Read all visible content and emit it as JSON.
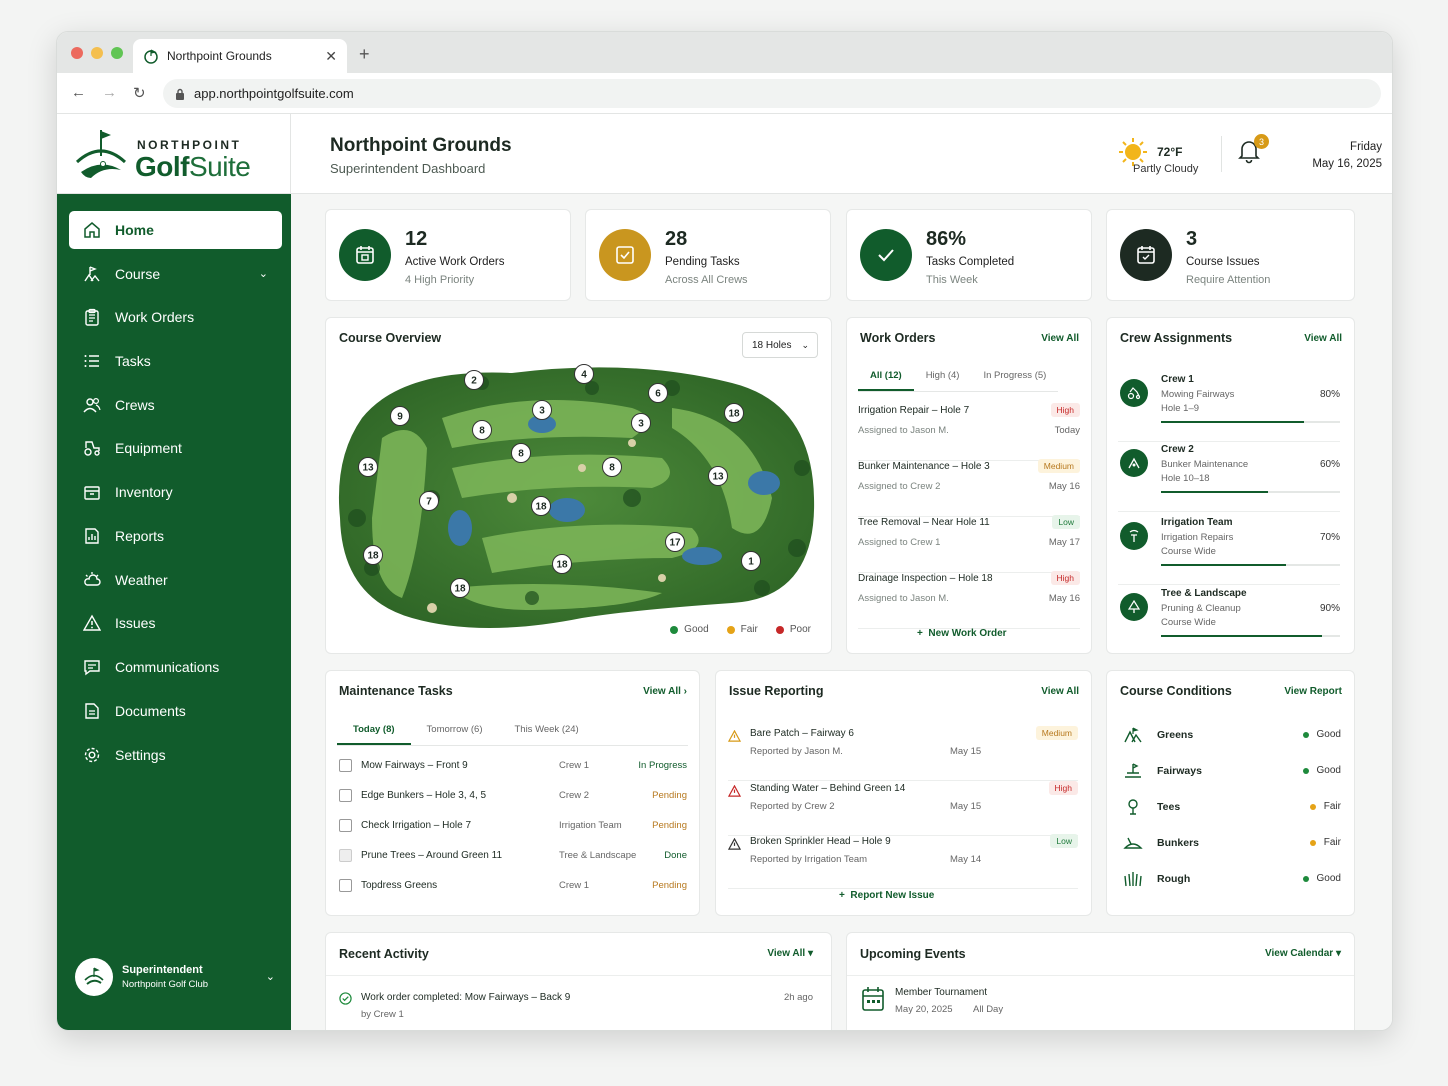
{
  "browser": {
    "tab_title": "Northpoint Grounds",
    "url": "app.northpointgolfsuite.com"
  },
  "brand": {
    "line1": "NORTHPOINT",
    "golf": "Golf",
    "suite": "Suite"
  },
  "sidebar": {
    "items": [
      {
        "label": "Home",
        "icon": "home-icon"
      },
      {
        "label": "Course",
        "icon": "course-icon"
      },
      {
        "label": "Work Orders",
        "icon": "clipboard-icon"
      },
      {
        "label": "Tasks",
        "icon": "list-icon"
      },
      {
        "label": "Crews",
        "icon": "users-icon"
      },
      {
        "label": "Equipment",
        "icon": "tractor-icon"
      },
      {
        "label": "Inventory",
        "icon": "box-icon"
      },
      {
        "label": "Reports",
        "icon": "chart-icon"
      },
      {
        "label": "Weather",
        "icon": "weather-icon"
      },
      {
        "label": "Issues",
        "icon": "warning-icon"
      },
      {
        "label": "Communications",
        "icon": "chat-icon"
      },
      {
        "label": "Documents",
        "icon": "document-icon"
      },
      {
        "label": "Settings",
        "icon": "gear-icon"
      }
    ],
    "user": {
      "role": "Superintendent",
      "club": "Northpoint Golf Club"
    }
  },
  "header": {
    "title": "Northpoint Grounds",
    "subtitle": "Superintendent Dashboard",
    "weather_temp": "72°F",
    "weather_cond": "Partly Cloudy",
    "notif_count": "3",
    "day": "Friday",
    "date": "May 16, 2025"
  },
  "stats": [
    {
      "value": "12",
      "label": "Active Work Orders",
      "sub": "4 High Priority",
      "color": "#115c2c"
    },
    {
      "value": "28",
      "label": "Pending Tasks",
      "sub": "Across All Crews",
      "color": "#c9961f"
    },
    {
      "value": "86%",
      "label": "Tasks Completed",
      "sub": "This Week",
      "color": "#115c2c"
    },
    {
      "value": "3",
      "label": "Course Issues",
      "sub": "Require Attention",
      "color": "#1d2a22"
    }
  ],
  "course_overview": {
    "title": "Course Overview",
    "select": "18 Holes",
    "hole_markers": [
      "2",
      "4",
      "6",
      "9",
      "3",
      "8",
      "3",
      "18",
      "13",
      "8",
      "8",
      "13",
      "7",
      "18",
      "17",
      "18",
      "18",
      "1",
      "18"
    ],
    "legend": [
      {
        "label": "Good",
        "color": "#1e8a3c"
      },
      {
        "label": "Fair",
        "color": "#e5a317"
      },
      {
        "label": "Poor",
        "color": "#c62828"
      }
    ]
  },
  "work_orders": {
    "title": "Work Orders",
    "view_all": "View All",
    "tabs": [
      "All (12)",
      "High (4)",
      "In Progress (5)"
    ],
    "items": [
      {
        "title": "Irrigation Repair – Hole 7",
        "assigned": "Assigned to Jason M.",
        "priority": "High",
        "date": "Today"
      },
      {
        "title": "Bunker Maintenance – Hole 3",
        "assigned": "Assigned to Crew 2",
        "priority": "Medium",
        "date": "May 16"
      },
      {
        "title": "Tree Removal – Near Hole 11",
        "assigned": "Assigned to Crew 1",
        "priority": "Low",
        "date": "May 17"
      },
      {
        "title": "Drainage Inspection – Hole 18",
        "assigned": "Assigned to Jason M.",
        "priority": "High",
        "date": "May 16"
      }
    ],
    "new_label": "New Work Order"
  },
  "crew_assignments": {
    "title": "Crew Assignments",
    "view_all": "View All",
    "items": [
      {
        "name": "Crew 1",
        "task": "Mowing Fairways",
        "area": "Hole 1–9",
        "pct": "80%",
        "progress": 0.8
      },
      {
        "name": "Crew 2",
        "task": "Bunker Maintenance",
        "area": "Hole 10–18",
        "pct": "60%",
        "progress": 0.6
      },
      {
        "name": "Irrigation Team",
        "task": "Irrigation Repairs",
        "area": "Course Wide",
        "pct": "70%",
        "progress": 0.7
      },
      {
        "name": "Tree & Landscape",
        "task": "Pruning & Cleanup",
        "area": "Course Wide",
        "pct": "90%",
        "progress": 0.9
      }
    ]
  },
  "maintenance": {
    "title": "Maintenance Tasks",
    "view_all": "View All",
    "tabs": [
      "Today (8)",
      "Tomorrow (6)",
      "This Week (24)"
    ],
    "items": [
      {
        "task": "Mow Fairways – Front 9",
        "crew": "Crew 1",
        "status": "In Progress",
        "done": false
      },
      {
        "task": "Edge Bunkers – Hole 3, 4, 5",
        "crew": "Crew 2",
        "status": "Pending",
        "done": false
      },
      {
        "task": "Check Irrigation – Hole 7",
        "crew": "Irrigation Team",
        "status": "Pending",
        "done": false
      },
      {
        "task": "Prune Trees – Around Green 11",
        "crew": "Tree & Landscape",
        "status": "Done",
        "done": true
      },
      {
        "task": "Topdress Greens",
        "crew": "Crew 1",
        "status": "Pending",
        "done": false
      }
    ]
  },
  "issues": {
    "title": "Issue Reporting",
    "view_all": "View All",
    "items": [
      {
        "title": "Bare Patch – Fairway 6",
        "reporter": "Reported by Jason M.",
        "date": "May 15",
        "priority": "Medium"
      },
      {
        "title": "Standing Water – Behind Green 14",
        "reporter": "Reported by Crew 2",
        "date": "May 15",
        "priority": "High"
      },
      {
        "title": "Broken Sprinkler Head – Hole 9",
        "reporter": "Reported by Irrigation Team",
        "date": "May 14",
        "priority": "Low"
      }
    ],
    "report_label": "Report New Issue"
  },
  "conditions": {
    "title": "Course Conditions",
    "view_report": "View Report",
    "items": [
      {
        "name": "Greens",
        "status": "Good",
        "icon": "greens-icon"
      },
      {
        "name": "Fairways",
        "status": "Good",
        "icon": "fairways-icon"
      },
      {
        "name": "Tees",
        "status": "Fair",
        "icon": "tees-icon"
      },
      {
        "name": "Bunkers",
        "status": "Fair",
        "icon": "bunkers-icon"
      },
      {
        "name": "Rough",
        "status": "Good",
        "icon": "rough-icon"
      }
    ]
  },
  "activity": {
    "title": "Recent Activity",
    "view_all": "View All",
    "items": [
      {
        "text": "Work order completed: Mow Fairways – Back 9",
        "by": "by Crew 1",
        "time": "2h ago"
      }
    ]
  },
  "events": {
    "title": "Upcoming Events",
    "view_calendar": "View Calendar",
    "items": [
      {
        "name": "Member Tournament",
        "date": "May 20, 2025",
        "time": "All Day"
      }
    ]
  }
}
